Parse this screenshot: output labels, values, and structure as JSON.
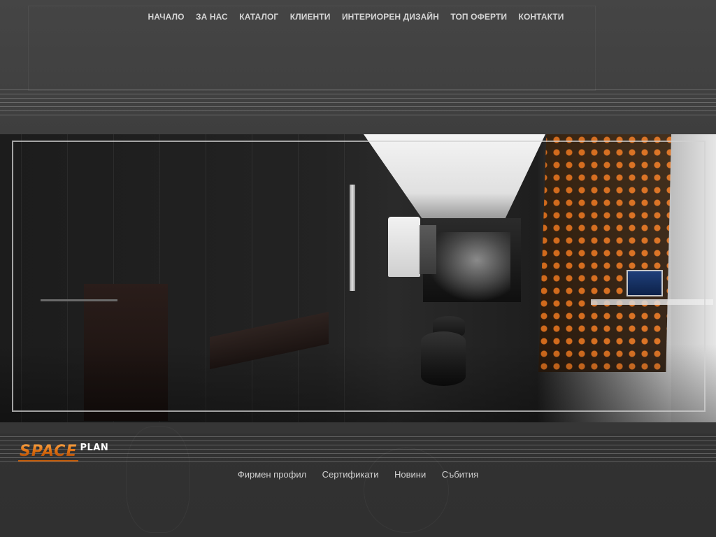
{
  "top_nav": {
    "items": [
      {
        "label": "НАЧАЛО"
      },
      {
        "label": "ЗА НАС"
      },
      {
        "label": "КАТАЛОГ"
      },
      {
        "label": "КЛИЕНТИ"
      },
      {
        "label": "ИНТЕРИОРЕН ДИЗАЙН"
      },
      {
        "label": "ТОП ОФЕРТИ"
      },
      {
        "label": "КОНТАКТИ"
      }
    ]
  },
  "logo": {
    "word_main": "SPACE",
    "word_sub": "PLAN",
    "accent_color": "#e06a10"
  },
  "footer_nav": {
    "items": [
      {
        "label": "Фирмен профил"
      },
      {
        "label": "Сертификати"
      },
      {
        "label": "Новини"
      },
      {
        "label": "Събития"
      }
    ]
  },
  "colors": {
    "background": "#3b3b3b",
    "nav_text": "#d6d6d6",
    "accent": "#e06a10"
  }
}
